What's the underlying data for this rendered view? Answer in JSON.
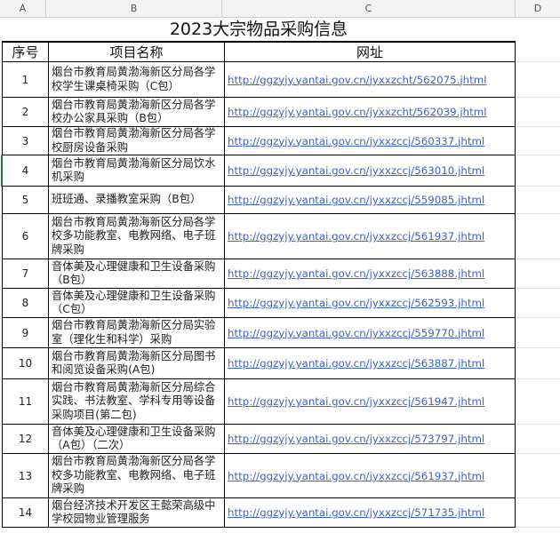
{
  "columns": [
    "A",
    "B",
    "C",
    "D"
  ],
  "sheet_title": "2023大宗物品采购信息",
  "table": {
    "headers": [
      "序号",
      "项目名称",
      "网址"
    ],
    "rows": [
      {
        "idx": "1",
        "name": "烟台市教育局黄渤海新区分局各学校学生课桌椅采购（C包）",
        "url": "http://ggzyjy.yantai.gov.cn/jyxxzcht/562075.jhtml"
      },
      {
        "idx": "2",
        "name": "烟台市教育局黄渤海新区分局各学校办公家具采购（B包）",
        "url": "http://ggzyjy.yantai.gov.cn/jyxxzcht/562039.jhtml"
      },
      {
        "idx": "3",
        "name": "烟台市教育局黄渤海新区分局各学校厨房设备采购",
        "url": "http://ggzyjy.yantai.gov.cn/jyxxzccj/560337.jhtml"
      },
      {
        "idx": "4",
        "name": "烟台市教育局黄渤海新区分局饮水机采购",
        "url": "http://ggzyjy.yantai.gov.cn/jyxxzccj/563010.jhtml"
      },
      {
        "idx": "5",
        "name": "班班通、录播教室采购（B包）",
        "url": "http://ggzyjy.yantai.gov.cn/jyxxzccj/559085.jhtml"
      },
      {
        "idx": "6",
        "name": "烟台市教育局黄渤海新区分局各学校多功能教室、电教网络、电子班牌采购",
        "url": "http://ggzyjy.yantai.gov.cn/jyxxzccj/561937.jhtml"
      },
      {
        "idx": "7",
        "name": "音体美及心理健康和卫生设备采购（B包）",
        "url": "http://ggzyjy.yantai.gov.cn/jyxxzccj/563888.jhtml"
      },
      {
        "idx": "8",
        "name": "音体美及心理健康和卫生设备采购（C包）",
        "url": "http://ggzyjy.yantai.gov.cn/jyxxzccj/562593.jhtml"
      },
      {
        "idx": "9",
        "name": "烟台市教育局黄渤海新区分局实验室（理化生和科学）采购",
        "url": "http://ggzyjy.yantai.gov.cn/jyxxzccj/559770.jhtml"
      },
      {
        "idx": "10",
        "name": "烟台市教育局黄渤海新区分局图书和阅览设备采购(A包)",
        "url": "http://ggzyjy.yantai.gov.cn/jyxxzccj/563887.jhtml"
      },
      {
        "idx": "11",
        "name": "烟台市教育局黄渤海新区分局综合实践、书法教室、学科专用等设备采购项目(第二包)",
        "url": "http://ggzyjy.yantai.gov.cn/jyxxzccj/561947.jhtml"
      },
      {
        "idx": "12",
        "name": "音体美及心理健康和卫生设备采购（A包）（二次）",
        "url": "http://ggzyjy.yantai.gov.cn/jyxxzccj/573797.jhtml"
      },
      {
        "idx": "13",
        "name": "烟台市教育局黄渤海新区分局各学校多功能教室、电教网络、电子班牌采购",
        "url": "http://ggzyjy.yantai.gov.cn/jyxxzccj/561937.jhtml"
      },
      {
        "idx": "14",
        "name": "烟台经济技术开发区王懿荣高级中学校园物业管理服务",
        "url": "http://ggzyjy.yantai.gov.cn/jyxxzccj/571735.jhtml"
      }
    ]
  },
  "colors": {
    "link": "#3d63c8",
    "grid_border": "#000000",
    "header_bg": "#f3f3f3",
    "selection": "#217346"
  }
}
